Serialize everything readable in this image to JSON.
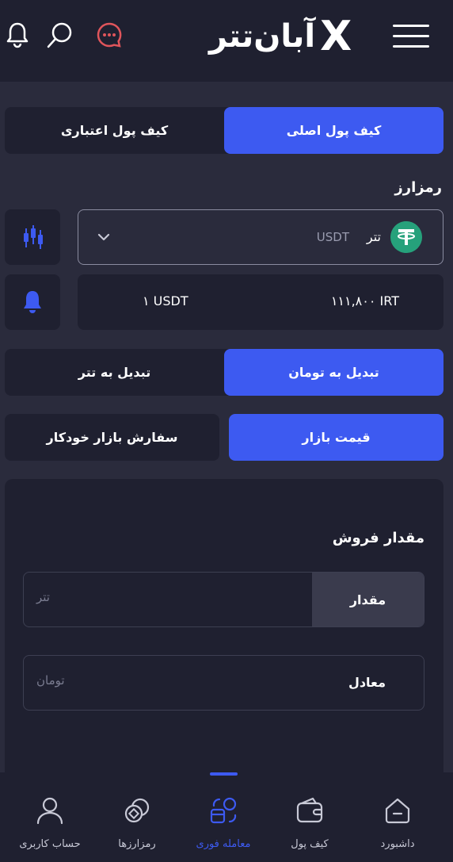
{
  "header": {
    "brand_name": "آبان‌تتر",
    "brand_mark": "X"
  },
  "wallet_tabs": {
    "main": "کیف پول اصلی",
    "credit": "کیف پول اعتباری"
  },
  "crypto": {
    "section_title": "رمزارز",
    "selected_name": "تتر",
    "selected_symbol": "USDT"
  },
  "price": {
    "irt": "۱۱۱,۸۰۰ IRT",
    "usdt": "۱ USDT"
  },
  "convert_tabs": {
    "to_toman": "تبدیل به تومان",
    "to_tether": "تبدیل به تتر"
  },
  "order_tabs": {
    "market": "قیمت بازار",
    "auto": "سفارش بازار خودکار"
  },
  "sell": {
    "title": "مقدار فروش",
    "amount_label": "مقدار",
    "amount_placeholder": "تتر",
    "equiv_label": "معادل",
    "equiv_placeholder": "تومان"
  },
  "nav": {
    "dashboard": "داشبورد",
    "wallet": "کیف پول",
    "instant": "معامله فوری",
    "cryptos": "رمزارزها",
    "account": "حساب کاربری"
  },
  "colors": {
    "accent": "#3d5af1",
    "background": "#2a2b3c",
    "surface": "#1f2030",
    "tether": "#26a17b",
    "chat": "#e0555b"
  }
}
